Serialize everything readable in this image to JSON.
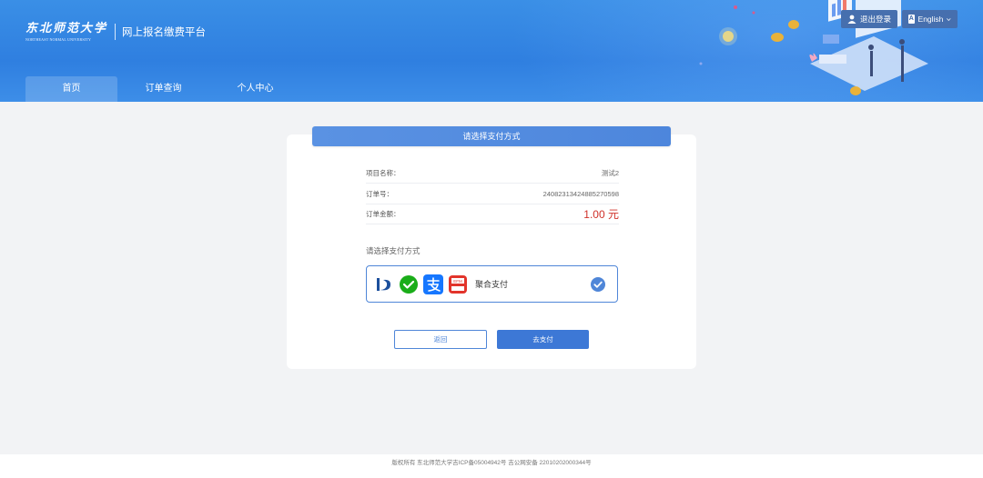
{
  "header": {
    "logo_cn": "东北师范大学",
    "logo_en": "NORTHEAST NORMAL UNIVERSITY",
    "platform_title": "网上报名缴费平台",
    "logout_label": "退出登录",
    "lang_icon": "A",
    "lang_label": "English"
  },
  "nav": {
    "items": [
      {
        "label": "首页",
        "active": true
      },
      {
        "label": "订单查询",
        "active": false
      },
      {
        "label": "个人中心",
        "active": false
      }
    ]
  },
  "payment": {
    "title": "请选择支付方式",
    "project_label": "项目名称：",
    "project_value": "测试2",
    "order_no_label": "订单号：",
    "order_no_value": "2408231342488527059​8",
    "amount_label": "订单金额：",
    "amount_value": "1.00 元",
    "method_prompt": "请选择支付方式",
    "method_name": "聚合支付",
    "method_icons": [
      "bank-icon",
      "wechat-pay-icon",
      "alipay-icon",
      "cash-register-icon"
    ],
    "back_label": "返回",
    "pay_label": "去支付"
  },
  "footer": {
    "text": "版权所有 东北师范大学吉ICP备05004942号 吉公网安备 22010202000344号"
  },
  "colors": {
    "header_blue": "#3a8fe6",
    "accent": "#4f86d8",
    "amount_red": "#d0312a"
  }
}
